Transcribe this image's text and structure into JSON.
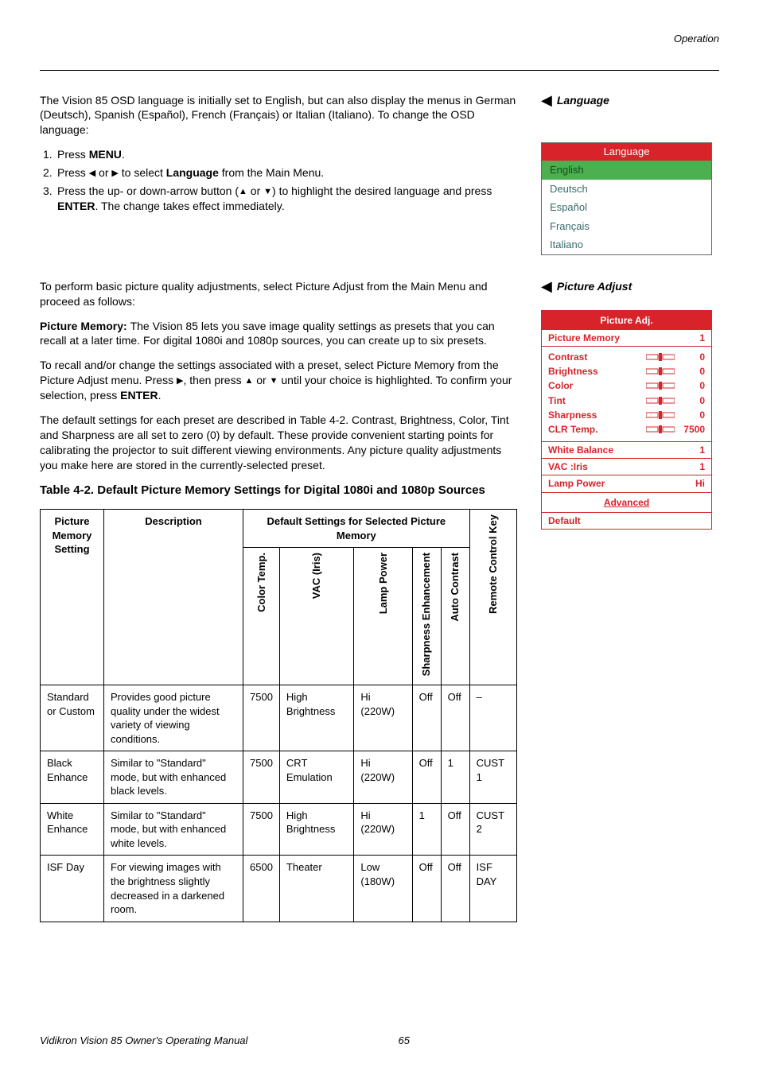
{
  "header": {
    "section": "Operation"
  },
  "sections": {
    "lang": {
      "side_label": "Language",
      "intro": "The Vision 85 OSD language is initially set to English, but can also display the menus in German (Deutsch), Spanish (Español), French (Français) or Italian (Italiano). To change the OSD language:",
      "steps": {
        "n1": "1.",
        "s1_a": "Press ",
        "s1_b": "MENU",
        "s1_c": ".",
        "n2": "2.",
        "s2_a": "Press ",
        "s2_b": " or ",
        "s2_c": " to select ",
        "s2_d": "Language",
        "s2_e": " from the Main Menu.",
        "n3": "3.",
        "s3_a": "Press the up- or down-arrow button (",
        "s3_b": " or ",
        "s3_c": ") to highlight the desired language and press ",
        "s3_d": "ENTER",
        "s3_e": ". The change takes effect immediately."
      },
      "menu": {
        "title": "Language",
        "items": [
          "English",
          "Deutsch",
          "Español",
          "Français",
          "Italiano"
        ],
        "selected": 0
      }
    },
    "pic": {
      "side_label": "Picture Adjust",
      "intro": "To perform basic picture quality adjustments, select Picture Adjust from the Main Menu and proceed as follows:",
      "mem_a": "Picture Memory: ",
      "mem_b": "The Vision 85 lets you save image quality settings as presets that you can recall at a later time. For digital 1080i and 1080p sources, you can create up to six presets.",
      "recall_a": "To recall and/or change the settings associated with a preset, select Picture Memory from the Picture Adjust menu. Press ",
      "recall_b": ", then press ",
      "recall_c": " or ",
      "recall_d": " until your choice is highlighted. To confirm your selection, press ",
      "recall_e": "ENTER",
      "recall_f": ".",
      "defaults": "The default settings for each preset are described in Table 4-2. Contrast, Brightness, Color, Tint and Sharpness are all set to zero (0) by default. These provide convenient starting points for calibrating the projector to suit different viewing environments. Any picture quality adjustments you make here are stored in the currently-selected preset.",
      "panel": {
        "title": "Picture Adj.",
        "pm_label": "Picture Memory",
        "pm_val": "1",
        "rows": [
          {
            "name": "Contrast",
            "val": "0"
          },
          {
            "name": "Brightness",
            "val": "0"
          },
          {
            "name": "Color",
            "val": "0"
          },
          {
            "name": "Tint",
            "val": "0"
          },
          {
            "name": "Sharpness",
            "val": "0"
          },
          {
            "name": "CLR Temp.",
            "val": "7500"
          }
        ],
        "wb_label": "White Balance",
        "wb_val": "1",
        "vac_label": "VAC :Iris",
        "vac_val": "1",
        "lp_label": "Lamp Power",
        "lp_val": "Hi",
        "adv": "Advanced",
        "def": "Default"
      }
    }
  },
  "table": {
    "title": "Table 4-2. Default Picture Memory Settings for Digital 1080i and 1080p Sources",
    "cols": {
      "c1": "Picture Memory Setting",
      "c2": "Description",
      "group": "Default Settings for Selected Picture Memory",
      "v1": "Color Temp.",
      "v2": "VAC (Iris)",
      "v3": "Lamp Power",
      "v4": "Sharpness Enhancement",
      "v5": "Auto Contrast",
      "v6": "Remote Control Key"
    },
    "rows": [
      {
        "s": "Standard or Custom",
        "d": "Provides good picture quality under the widest variety of viewing conditions.",
        "ct": "7500",
        "vac": "High Brightness",
        "lp": "Hi (220W)",
        "se": "Off",
        "ac": "Off",
        "rc": "–"
      },
      {
        "s": "Black Enhance",
        "d": "Similar to \"Standard\" mode, but with enhanced black levels.",
        "ct": "7500",
        "vac": "CRT Emulation",
        "lp": "Hi (220W)",
        "se": "Off",
        "ac": "1",
        "rc": "CUST 1"
      },
      {
        "s": "White Enhance",
        "d": "Similar to \"Standard\" mode, but with enhanced white levels.",
        "ct": "7500",
        "vac": "High Brightness",
        "lp": "Hi (220W)",
        "se": "1",
        "ac": "Off",
        "rc": "CUST 2"
      },
      {
        "s": "ISF Day",
        "d": "For viewing images with the brightness slightly decreased in a darkened room.",
        "ct": "6500",
        "vac": "Theater",
        "lp": "Low (180W)",
        "se": "Off",
        "ac": "Off",
        "rc": "ISF DAY"
      }
    ]
  },
  "footer": {
    "left": "Vidikron Vision 85 Owner's Operating Manual",
    "page": "65"
  }
}
